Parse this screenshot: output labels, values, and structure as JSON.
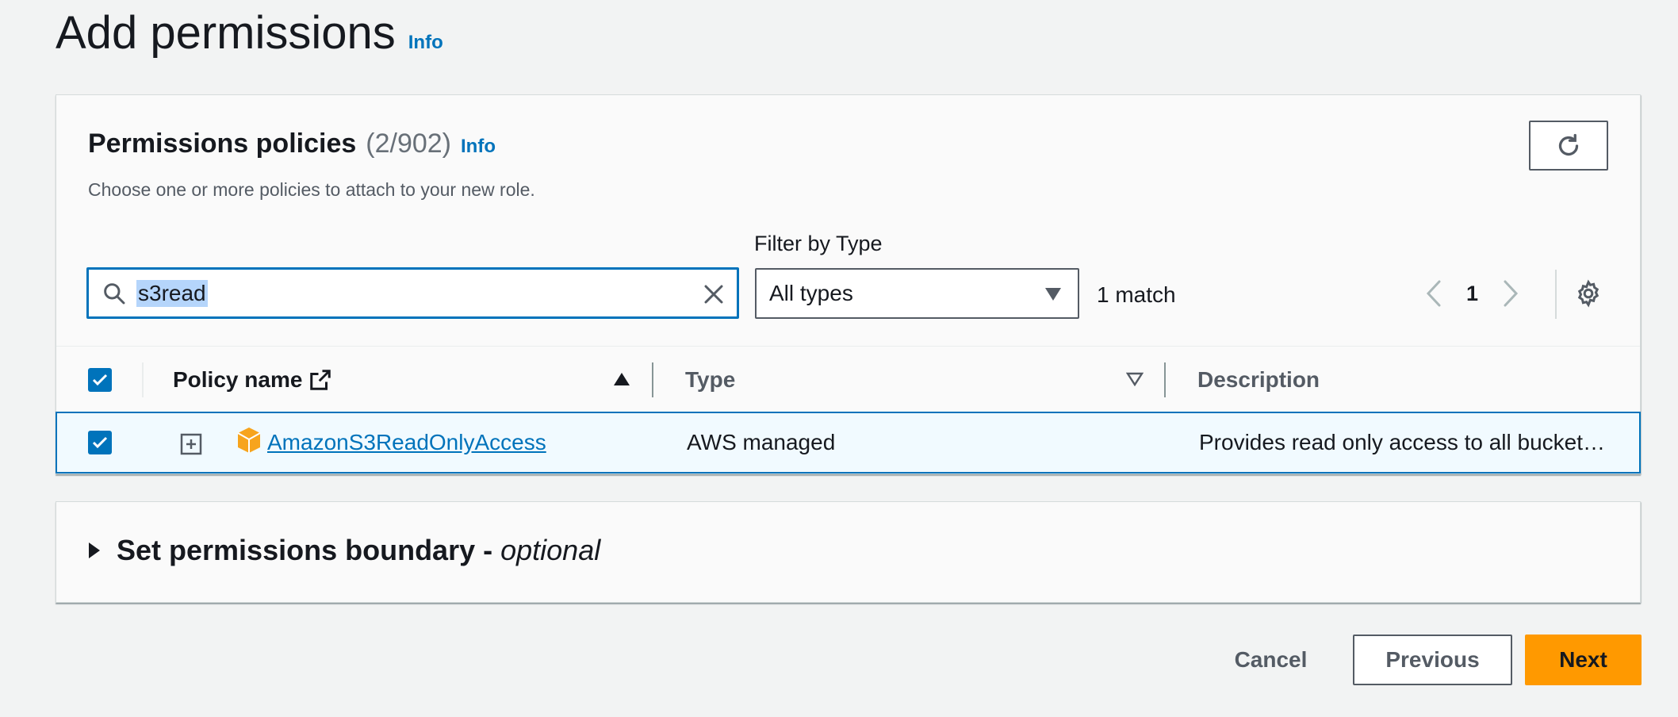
{
  "page": {
    "title": "Add permissions",
    "info": "Info"
  },
  "panel": {
    "title": "Permissions policies",
    "count": "(2/902)",
    "info": "Info",
    "description": "Choose one or more policies to attach to your new role."
  },
  "filter": {
    "label": "Filter by Type",
    "search_value": "s3read",
    "type_selected": "All types",
    "match_count": "1 match",
    "page_number": "1"
  },
  "table": {
    "columns": {
      "name": "Policy name",
      "type": "Type",
      "description": "Description"
    },
    "rows": [
      {
        "name": "AmazonS3ReadOnlyAccess",
        "type": "AWS managed",
        "description": "Provides read only access to all bucket…",
        "selected": true
      }
    ]
  },
  "boundary": {
    "label": "Set permissions boundary - ",
    "optional": "optional"
  },
  "footer": {
    "cancel": "Cancel",
    "previous": "Previous",
    "next": "Next"
  },
  "colors": {
    "accent": "#0073bb",
    "primary_button": "#ff9900",
    "selected_row": "#f1faff"
  }
}
